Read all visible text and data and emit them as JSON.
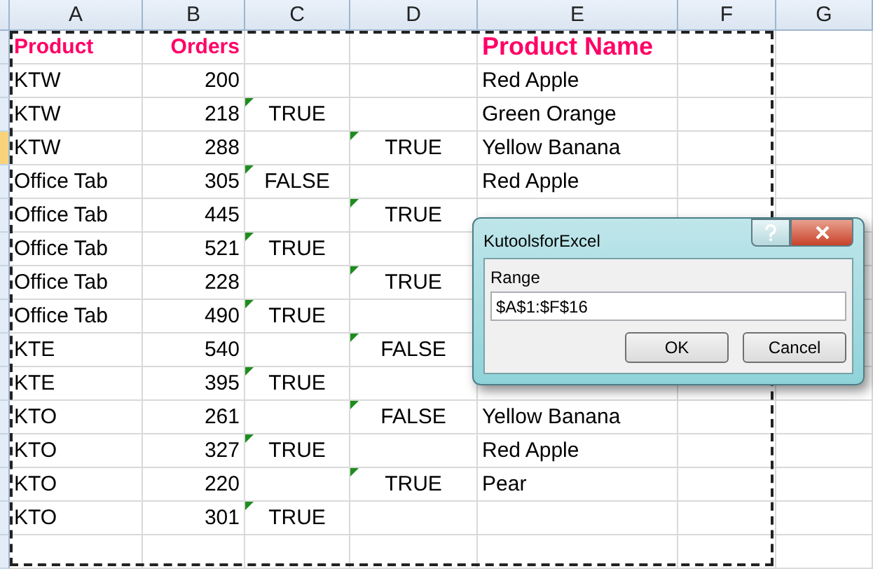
{
  "columns": [
    {
      "label": "A"
    },
    {
      "label": "B"
    },
    {
      "label": "C"
    },
    {
      "label": "D"
    },
    {
      "label": "E"
    },
    {
      "label": "F"
    },
    {
      "label": "G"
    }
  ],
  "header_row": {
    "selected": false,
    "cells": [
      "Product",
      "Orders",
      "",
      "",
      "Product Name"
    ]
  },
  "rows": [
    {
      "selected": false,
      "cells": [
        "KTW",
        "200",
        "",
        "",
        "Red Apple"
      ]
    },
    {
      "selected": false,
      "cells": [
        "KTW",
        "218",
        "TRUE",
        "",
        "Green Orange"
      ]
    },
    {
      "selected": true,
      "cells": [
        "KTW",
        "288",
        "",
        "TRUE",
        "Yellow Banana"
      ]
    },
    {
      "selected": false,
      "cells": [
        "Office Tab",
        "305",
        "FALSE",
        "",
        "Red Apple"
      ]
    },
    {
      "selected": false,
      "cells": [
        "Office Tab",
        "445",
        "",
        "TRUE",
        ""
      ]
    },
    {
      "selected": false,
      "cells": [
        "Office Tab",
        "521",
        "TRUE",
        "",
        ""
      ]
    },
    {
      "selected": false,
      "cells": [
        "Office Tab",
        "228",
        "",
        "TRUE",
        ""
      ]
    },
    {
      "selected": false,
      "cells": [
        "Office Tab",
        "490",
        "TRUE",
        "",
        ""
      ]
    },
    {
      "selected": false,
      "cells": [
        "KTE",
        "540",
        "",
        "FALSE",
        ""
      ]
    },
    {
      "selected": false,
      "cells": [
        "KTE",
        "395",
        "TRUE",
        "",
        ""
      ]
    },
    {
      "selected": false,
      "cells": [
        "KTO",
        "261",
        "",
        "FALSE",
        "Yellow Banana"
      ]
    },
    {
      "selected": false,
      "cells": [
        "KTO",
        "327",
        "TRUE",
        "",
        "Red Apple"
      ]
    },
    {
      "selected": false,
      "cells": [
        "KTO",
        "220",
        "",
        "TRUE",
        "Pear"
      ]
    },
    {
      "selected": false,
      "cells": [
        "KTO",
        "301",
        "TRUE",
        "",
        ""
      ]
    },
    {
      "selected": false,
      "cells": [
        "",
        "",
        "",
        "",
        ""
      ]
    }
  ],
  "dialog": {
    "title": "KutoolsforExcel",
    "field_label": "Range",
    "field_value": "$A$1:$F$16",
    "buttons": [
      "OK",
      "Cancel"
    ]
  }
}
